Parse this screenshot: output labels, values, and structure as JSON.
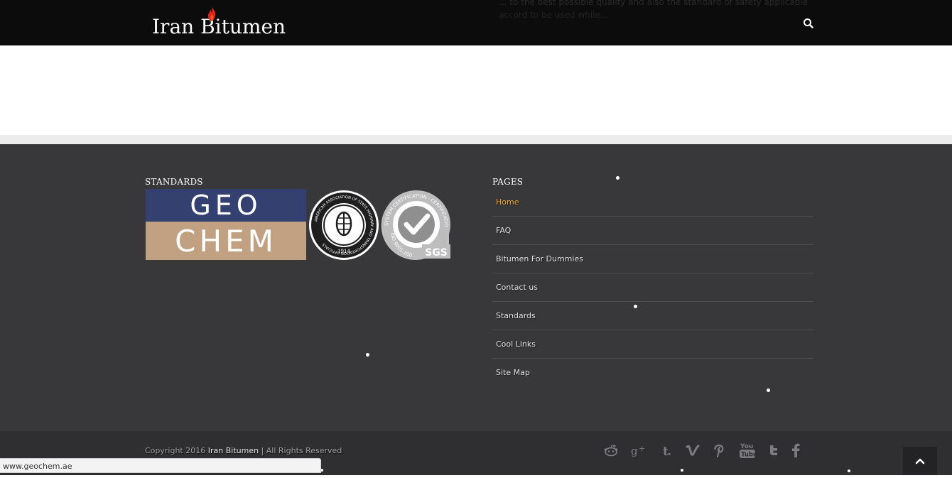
{
  "header": {
    "logo_text": "Iran Bitumen",
    "ghost_text_line1": "... to the best possible quality and also the standard of safety applicable ...",
    "ghost_text_line2": "accord to be used while..."
  },
  "footer": {
    "standards_title": "STANDARDS",
    "pages_title": "PAGES",
    "geochem_top": "GEO",
    "geochem_bottom": "CHEM",
    "aashto_ring_text": "AMERICAN ASSOCIATION OF STATE HIGHWAY AND TRANSPORTATION OFFICIALS",
    "aashto_year": "1914",
    "sgs_ring_text": "SYSTEM CERTIFICATION · CERTIFICATION DE SYSTEMES",
    "sgs_iso": "ISO 9001:2000",
    "sgs_brand": "SGS",
    "pages": [
      {
        "label": "Home",
        "active": true
      },
      {
        "label": "FAQ",
        "active": false
      },
      {
        "label": "Bitumen For Dummies",
        "active": false
      },
      {
        "label": "Contact us",
        "active": false
      },
      {
        "label": "Standards",
        "active": false
      },
      {
        "label": "Cool Links",
        "active": false
      },
      {
        "label": "Site Map",
        "active": false
      }
    ]
  },
  "bottom_bar": {
    "copyright_prefix": "Copyright 2016",
    "copyright_brand": "Iran Bitumen",
    "copyright_suffix": "| All Rights Reserved",
    "social_icons": [
      "reddit-icon",
      "google-plus-icon",
      "tumblr-icon",
      "vimeo-icon",
      "pinterest-icon",
      "youtube-icon",
      "twitter-icon",
      "facebook-icon"
    ]
  },
  "status_bar": {
    "url": "www.geochem.ae"
  },
  "colors": {
    "header_bg": "#0c0c0c",
    "footer_bg": "#38383b",
    "bottom_bar_bg": "#2f2f31",
    "active_link": "#f0a326",
    "flame": "#e0261b",
    "geochem_blue": "#344170",
    "geochem_tan": "#c2a182"
  }
}
